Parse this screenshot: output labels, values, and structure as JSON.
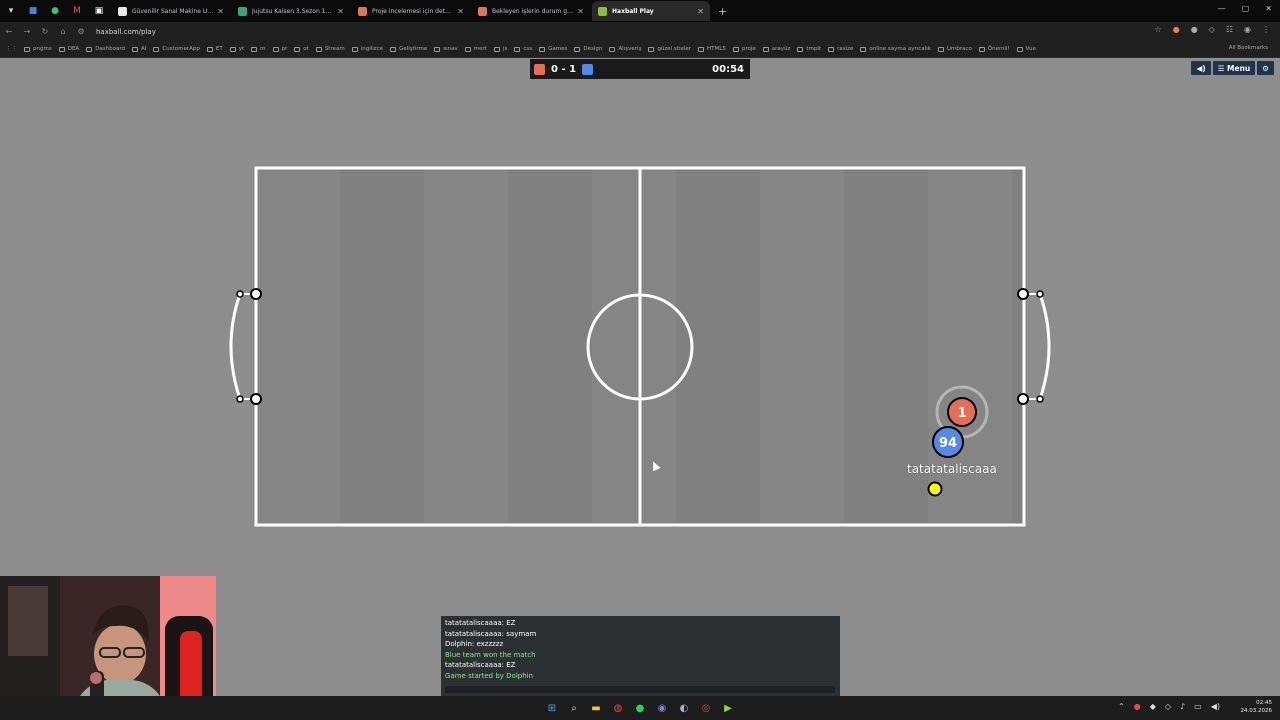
{
  "browser": {
    "tabs": [
      {
        "title": "Güvenilir Sanal Makine Uygulaması",
        "color": "#e9e9e9",
        "active": false
      },
      {
        "title": "Jujutsu Kaisen 3.Sezon 11. Bölüm",
        "color": "#3aa675",
        "active": false
      },
      {
        "title": "Proje incelemesi için detaylı prompt",
        "color": "#d97757",
        "active": false
      },
      {
        "title": "Bekleyen işlerin durum güncellemesi",
        "color": "#d97757",
        "active": false
      },
      {
        "title": "Haxball Play",
        "color": "#8bbf3a",
        "active": true
      }
    ],
    "new_tab_label": "+",
    "url": "haxball.com/play",
    "bookmarks": [
      "pngms",
      "DEA",
      "Dashboard",
      "AI",
      "CustomerApp",
      "ET",
      "yt",
      "m",
      "pr",
      "ot",
      "Stream",
      "ingilizce",
      "Geliştirme",
      "sınav",
      "mert",
      "js",
      "css",
      "Games",
      "Design",
      "Alışveriş",
      "güzel siteler",
      "HTML5",
      "proje",
      "arayüz",
      "tmplt",
      "rasize",
      "online sayma ayrıcalık",
      "Umbraco",
      "Önemli!",
      "Vue"
    ],
    "bookmarks_right": "All Bookmarks"
  },
  "scoreboard": {
    "red_score": "0",
    "separator": "-",
    "blue_score": "1",
    "timer": "00:54",
    "red_color": "#e56e56",
    "blue_color": "#5689e5"
  },
  "controls": {
    "sound_icon": "speaker-icon",
    "menu_label": "☰ Menu",
    "settings_icon": "gear-icon"
  },
  "players": [
    {
      "label": "1",
      "team": "red",
      "color": "#e56e56"
    },
    {
      "label": "94",
      "team": "blue",
      "color": "#5689e5"
    }
  ],
  "player_name": "tatatataliscaaa",
  "chat": {
    "messages": [
      {
        "text": "tatatataliscaaaa: EZ",
        "type": "player"
      },
      {
        "text": "tatatataliscaaaa: saymam",
        "type": "player"
      },
      {
        "text": "Dolphin: exzzzzz",
        "type": "player"
      },
      {
        "text": "Blue team won the match",
        "type": "system"
      },
      {
        "text": "tatatataliscaaaa: EZ",
        "type": "player"
      },
      {
        "text": "Game started by Dolphin",
        "type": "system"
      }
    ],
    "input_value": ""
  },
  "taskbar": {
    "time": "02:45",
    "date": "24.03.2026"
  }
}
